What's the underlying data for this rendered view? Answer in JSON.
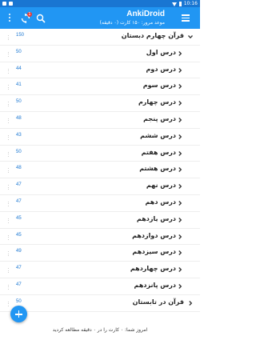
{
  "status_bar": {
    "time": "10:16"
  },
  "toolbar": {
    "title": "AnkiDroid",
    "subtitle": "موعد مرور: ۱۵۰ کارت (۰ دقیقه)",
    "sync_badge": "1",
    "colors": {
      "toolbar": "#2196f3",
      "status_bar": "#1976d2"
    }
  },
  "decks": [
    {
      "name": "قرآن چهارم دبستان",
      "count": "150",
      "expanded": true,
      "level": 0
    },
    {
      "name": "درس اول",
      "count": "50",
      "level": 1
    },
    {
      "name": "درس دوم",
      "count": "44",
      "level": 1
    },
    {
      "name": "درس سوم",
      "count": "41",
      "level": 1
    },
    {
      "name": "درس چهارم",
      "count": "50",
      "level": 1
    },
    {
      "name": "درس پنجم",
      "count": "48",
      "level": 1
    },
    {
      "name": "درس ششم",
      "count": "43",
      "level": 1
    },
    {
      "name": "درس هفتم",
      "count": "50",
      "level": 1
    },
    {
      "name": "درس هشتم",
      "count": "48",
      "level": 1
    },
    {
      "name": "درس نهم",
      "count": "47",
      "level": 1
    },
    {
      "name": "درس دهم",
      "count": "47",
      "level": 1
    },
    {
      "name": "درس یازدهم",
      "count": "45",
      "level": 1
    },
    {
      "name": "درس دوازدهم",
      "count": "45",
      "level": 1
    },
    {
      "name": "درس سیزدهم",
      "count": "49",
      "level": 1
    },
    {
      "name": "درس چهاردهم",
      "count": "47",
      "level": 1
    },
    {
      "name": "درس پانزدهم",
      "count": "47",
      "level": 1
    },
    {
      "name": "قرآن در تابستان",
      "count": "50",
      "level": 0
    }
  ],
  "footer": {
    "text": "امروز شما: ۰ کارت را در ۰ دقیقه مطالعه کردید"
  },
  "fab": {
    "icon": "plus-icon"
  }
}
